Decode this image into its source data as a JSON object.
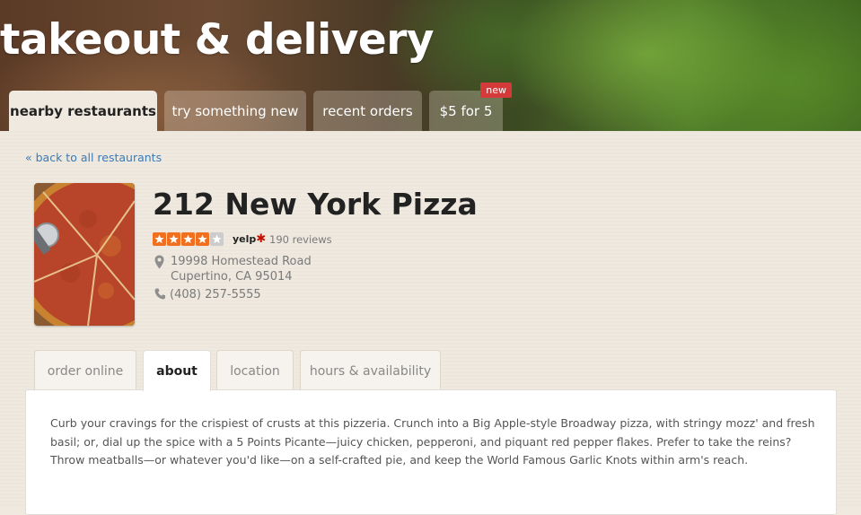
{
  "hero": {
    "title": "takeout & delivery"
  },
  "top_tabs": [
    {
      "label": "nearby restaurants",
      "active": true
    },
    {
      "label": "try something new",
      "active": false
    },
    {
      "label": "recent orders",
      "active": false
    },
    {
      "label": "$5 for 5",
      "active": false,
      "badge": "new"
    }
  ],
  "back_link": "« back to all restaurants",
  "restaurant": {
    "name": "212 New York Pizza",
    "rating": 4,
    "rating_max": 5,
    "rating_source": "yelp",
    "reviews": "190 reviews",
    "address_line1": "19998 Homestead Road",
    "address_line2": "Cupertino, CA 95014",
    "phone": "(408) 257-5555"
  },
  "inner_tabs": [
    {
      "label": "order online",
      "active": false
    },
    {
      "label": "about",
      "active": true
    },
    {
      "label": "location",
      "active": false
    },
    {
      "label": "hours & availability",
      "active": false
    }
  ],
  "about": {
    "text": "Curb your cravings for the crispiest of crusts at this pizzeria. Crunch into a Big Apple-style Broadway pizza, with stringy mozz' and fresh basil; or, dial up the spice with a 5 Points Picante—juicy chicken, pepperoni, and piquant red pepper flakes. Prefer to take the reins? Throw meatballs—or whatever you'd like—on a self-crafted pie, and keep the World Famous Garlic Knots within arm's reach."
  },
  "colors": {
    "link": "#3b7bb8",
    "star": "#f07020",
    "badge": "#d43a3a"
  }
}
